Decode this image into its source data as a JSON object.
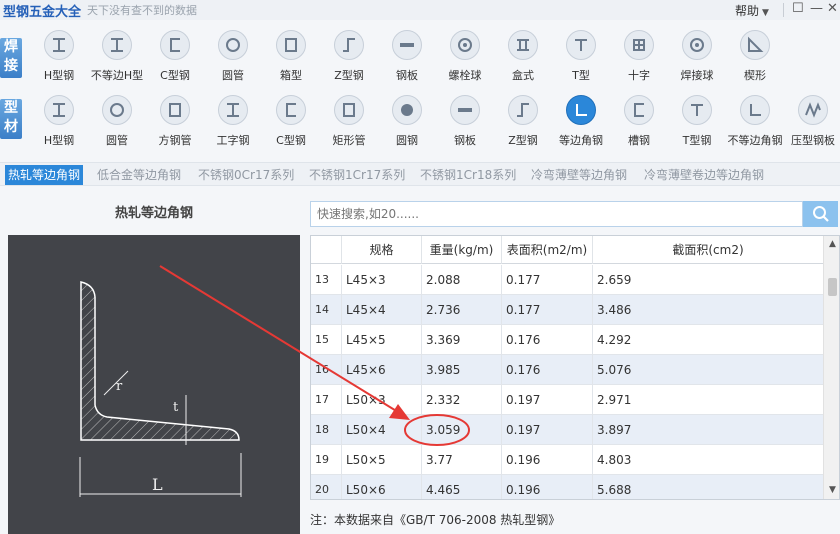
{
  "app": {
    "title": "型钢五金大全",
    "slogan": "天下没有查不到的数据",
    "help_label": "帮助",
    "pin_glyph": "☐",
    "minimize_glyph": "—",
    "close_glyph": "✕"
  },
  "rows": {
    "welded": {
      "label_top": "焊",
      "label_bottom": "接",
      "items": [
        {
          "label": "H型钢",
          "icon": "h-beam-icon"
        },
        {
          "label": "不等边H型",
          "icon": "unequal-h-beam-icon"
        },
        {
          "label": "C型钢",
          "icon": "c-channel-icon"
        },
        {
          "label": "圆管",
          "icon": "round-tube-icon"
        },
        {
          "label": "箱型",
          "icon": "box-section-icon"
        },
        {
          "label": "Z型钢",
          "icon": "z-section-icon"
        },
        {
          "label": "钢板",
          "icon": "steel-plate-icon"
        },
        {
          "label": "螺栓球",
          "icon": "bolt-ball-icon"
        },
        {
          "label": "盒式",
          "icon": "box-type-icon"
        },
        {
          "label": "T型",
          "icon": "t-section-icon"
        },
        {
          "label": "十字",
          "icon": "cross-section-icon"
        },
        {
          "label": "焊接球",
          "icon": "welded-ball-icon"
        },
        {
          "label": "楔形",
          "icon": "wedge-icon"
        }
      ]
    },
    "profile": {
      "label_top": "型",
      "label_bottom": "材",
      "items": [
        {
          "label": "H型钢",
          "icon": "h-beam-icon"
        },
        {
          "label": "圆管",
          "icon": "round-tube-icon"
        },
        {
          "label": "方钢管",
          "icon": "square-tube-icon"
        },
        {
          "label": "工字钢",
          "icon": "i-beam-icon"
        },
        {
          "label": "C型钢",
          "icon": "c-channel-icon"
        },
        {
          "label": "矩形管",
          "icon": "rect-tube-icon"
        },
        {
          "label": "圆钢",
          "icon": "round-bar-icon"
        },
        {
          "label": "钢板",
          "icon": "steel-plate-icon"
        },
        {
          "label": "Z型钢",
          "icon": "z-section-icon"
        },
        {
          "label": "等边角钢",
          "icon": "equal-angle-icon"
        },
        {
          "label": "槽钢",
          "icon": "channel-icon"
        },
        {
          "label": "T型钢",
          "icon": "t-section-icon"
        },
        {
          "label": "不等边角钢",
          "icon": "unequal-angle-icon"
        },
        {
          "label": "压型钢板",
          "icon": "profiled-sheet-icon"
        }
      ],
      "active_index": 9
    }
  },
  "subtabs": [
    "热轧等边角钢",
    "低合金等边角钢",
    "不锈钢0Cr17系列",
    "不锈钢1Cr17系列",
    "不锈钢1Cr18系列",
    "冷弯薄壁等边角钢",
    "冷弯薄壁卷边等边角钢"
  ],
  "left_panel": {
    "title": "热轧等边角钢",
    "diagram_r": "r",
    "diagram_t": "t",
    "diagram_L": "L"
  },
  "search": {
    "placeholder": "快速搜索,如20......"
  },
  "table": {
    "headers": [
      "",
      "规格",
      "重量(kg/m)",
      "表面积(m2/m)",
      "截面积(cm2)"
    ],
    "rows": [
      [
        "13",
        "L45×3",
        "2.088",
        "0.177",
        "2.659"
      ],
      [
        "14",
        "L45×4",
        "2.736",
        "0.177",
        "3.486"
      ],
      [
        "15",
        "L45×5",
        "3.369",
        "0.176",
        "4.292"
      ],
      [
        "16",
        "L45×6",
        "3.985",
        "0.176",
        "5.076"
      ],
      [
        "17",
        "L50×3",
        "2.332",
        "0.197",
        "2.971"
      ],
      [
        "18",
        "L50×4",
        "3.059",
        "0.197",
        "3.897"
      ],
      [
        "19",
        "L50×5",
        "3.77",
        "0.196",
        "4.803"
      ],
      [
        "20",
        "L50×6",
        "4.465",
        "0.196",
        "5.688"
      ]
    ]
  },
  "note": "注：本数据来自《GB/T  706-2008  热轧型钢》",
  "colors": {
    "accent": "#2b87d9",
    "annotation": "#e53935"
  }
}
